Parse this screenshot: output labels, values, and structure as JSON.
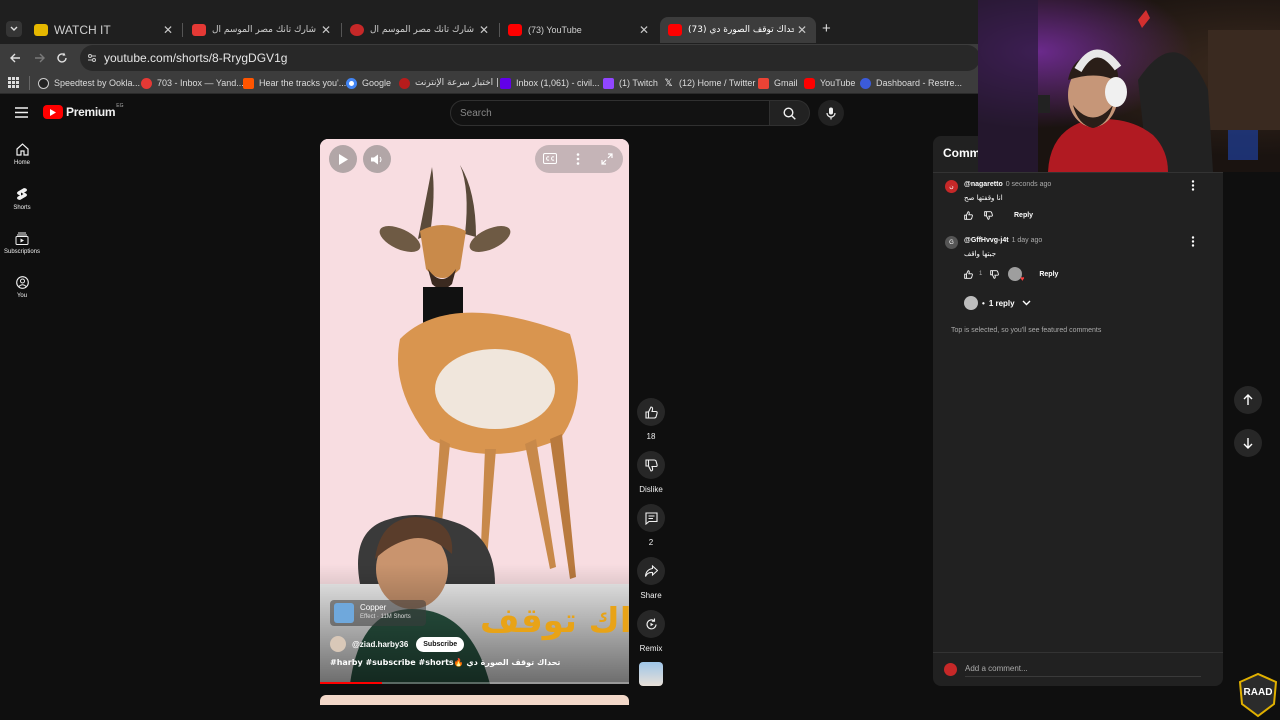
{
  "browser": {
    "tabs": [
      {
        "title": "WATCH IT",
        "color": "#e6b800",
        "active": false
      },
      {
        "title": "برنامج شارك تانك مصر الموسم ال",
        "color": "#e53935",
        "active": false
      },
      {
        "title": "برنامج شارك تانك مصر الموسم ال",
        "color": "#c62828",
        "active": false
      },
      {
        "title": "(73) YouTube",
        "color": "#ff0000",
        "active": false
      },
      {
        "title": "(73) تحداك توقف الصورة دي 🔥",
        "color": "#ff0000",
        "active": true
      }
    ],
    "new_tab": "+",
    "url": "youtube.com/shorts/8-RrygDGV1g",
    "bookmarks": [
      {
        "label": "Speedtest by Ookla...",
        "color": "#333333"
      },
      {
        "label": "703 - Inbox — Yand...",
        "color": "#e53935"
      },
      {
        "label": "Hear the tracks you'...",
        "color": "#ff5500"
      },
      {
        "label": "Google",
        "color": "#4285f4"
      },
      {
        "label": "اختبار سرعة الإنترنت |...",
        "color": "#b71c1c"
      },
      {
        "label": "Inbox (1,061) - civil...",
        "color": "#6200ea"
      },
      {
        "label": "(1) Twitch",
        "color": "#9146ff"
      },
      {
        "label": "(12) Home / Twitter",
        "color": "#ffffff"
      },
      {
        "label": "Gmail",
        "color": "#ea4335"
      },
      {
        "label": "YouTube",
        "color": "#ff0000"
      },
      {
        "label": "Dashboard - Restre...",
        "color": "#3b5bdb"
      }
    ]
  },
  "youtube": {
    "logo": "Premium",
    "country": "EG",
    "search_placeholder": "Search",
    "guide": [
      {
        "label": "Home",
        "icon": "home-icon"
      },
      {
        "label": "Shorts",
        "icon": "shorts-icon"
      },
      {
        "label": "Subscriptions",
        "icon": "subscriptions-icon"
      },
      {
        "label": "You",
        "icon": "you-icon"
      }
    ]
  },
  "short": {
    "banner_text": "تحداك توقف",
    "effect_name": "Copper",
    "effect_meta": "Effect · 11M Shorts",
    "channel": "@ziad.harby36",
    "subscribe": "Subscribe",
    "caption": "#harby #subscribe #shorts🔥 تحداك توقف الصورة دي",
    "progress": 0.2
  },
  "actions": {
    "likes": "18",
    "dislike": "Dislike",
    "comments": "2",
    "share": "Share",
    "remix": "Remix"
  },
  "comments": {
    "title": "Comments",
    "items": [
      {
        "user": "@nagaretto",
        "time": "0 seconds ago",
        "text": "انا وقفتها صح",
        "likes": "",
        "reply": "Reply",
        "avatar": "ن",
        "avatar_color": "#c62828"
      },
      {
        "user": "@GffHvvg-j4t",
        "time": "1 day ago",
        "text": "جبتها واقف",
        "likes": "1",
        "reply": "Reply",
        "avatar": "G",
        "avatar_color": "#555555"
      }
    ],
    "replies_toggle": "1 reply",
    "footer_note": "Top is selected, so you'll see featured comments",
    "add_placeholder": "Add a comment..."
  },
  "overlay": {
    "stream_logo": "RAAD"
  }
}
